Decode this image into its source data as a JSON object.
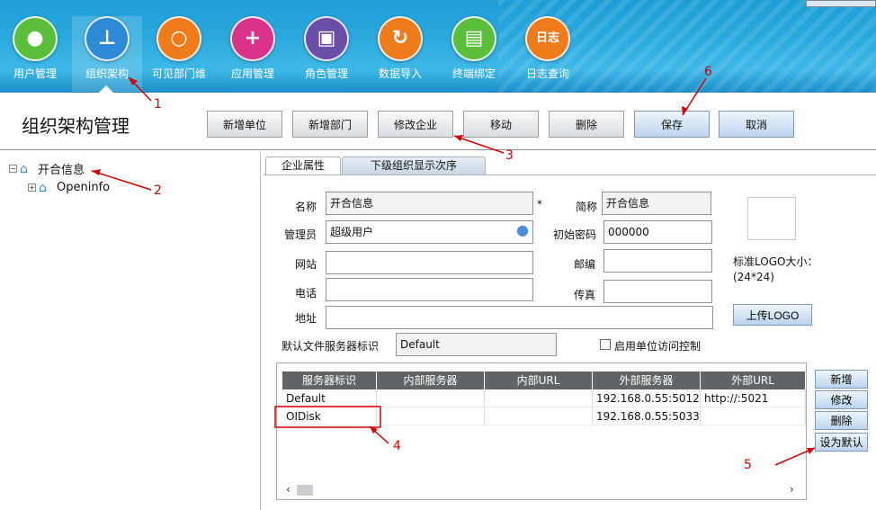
{
  "modules": [
    {
      "label": "用户管理",
      "icon": "users-icon",
      "color": "#5bbf3c"
    },
    {
      "label": "组织架构",
      "icon": "org-chart-icon",
      "color": "#2f8ad6"
    },
    {
      "label": "可见部门维",
      "icon": "search-icon",
      "color": "#f07b1a"
    },
    {
      "label": "应用管理",
      "icon": "app-add-icon",
      "color": "#d9338a"
    },
    {
      "label": "角色管理",
      "icon": "contact-card-icon",
      "color": "#6b4ea8"
    },
    {
      "label": "数据导入",
      "icon": "refresh-icon",
      "color": "#f07b1a"
    },
    {
      "label": "终端绑定",
      "icon": "terminal-bind-icon",
      "color": "#5bbf3c"
    },
    {
      "label": "日志查询",
      "icon": "log-icon",
      "color": "#f07b1a",
      "text": "日志"
    }
  ],
  "page_title": "组织架构管理",
  "toolbar": {
    "add_unit": "新增单位",
    "add_dept": "新增部门",
    "edit_company": "修改企业",
    "move": "移动",
    "delete": "删除",
    "save": "保存",
    "cancel": "取消"
  },
  "tree": {
    "root": "开合信息",
    "child": "Openinfo"
  },
  "tabs": {
    "props": "企业属性",
    "order": "下级组织显示次序"
  },
  "form": {
    "name_label": "名称",
    "name_value": "开合信息",
    "required_mark": "*",
    "short_label": "简称",
    "short_value": "开合信息",
    "admin_label": "管理员",
    "admin_value": "超级用户",
    "pwd_label": "初始密码",
    "pwd_value": "000000",
    "site_label": "网站",
    "zip_label": "邮编",
    "tel_label": "电话",
    "fax_label": "传真",
    "addr_label": "地址",
    "fs_label": "默认文件服务器标识",
    "fs_value": "Default",
    "access_label": "启用单位访问控制"
  },
  "logo": {
    "hint": "标准LOGO大小：(24*24)",
    "upload": "上传LOGO"
  },
  "servers": {
    "columns": [
      "服务器标识",
      "内部服务器",
      "内部URL",
      "外部服务器",
      "外部URL"
    ],
    "rows": [
      [
        "Default",
        "",
        "",
        "192.168.0.55:5012",
        "http://:5021"
      ],
      [
        "OIDisk",
        "",
        "",
        "192.168.0.55:5033",
        ""
      ]
    ]
  },
  "server_buttons": {
    "add": "新增",
    "edit": "修改",
    "delete": "删除",
    "set_default": "设为默认"
  },
  "annotations": [
    "1",
    "2",
    "3",
    "4",
    "5",
    "6"
  ]
}
